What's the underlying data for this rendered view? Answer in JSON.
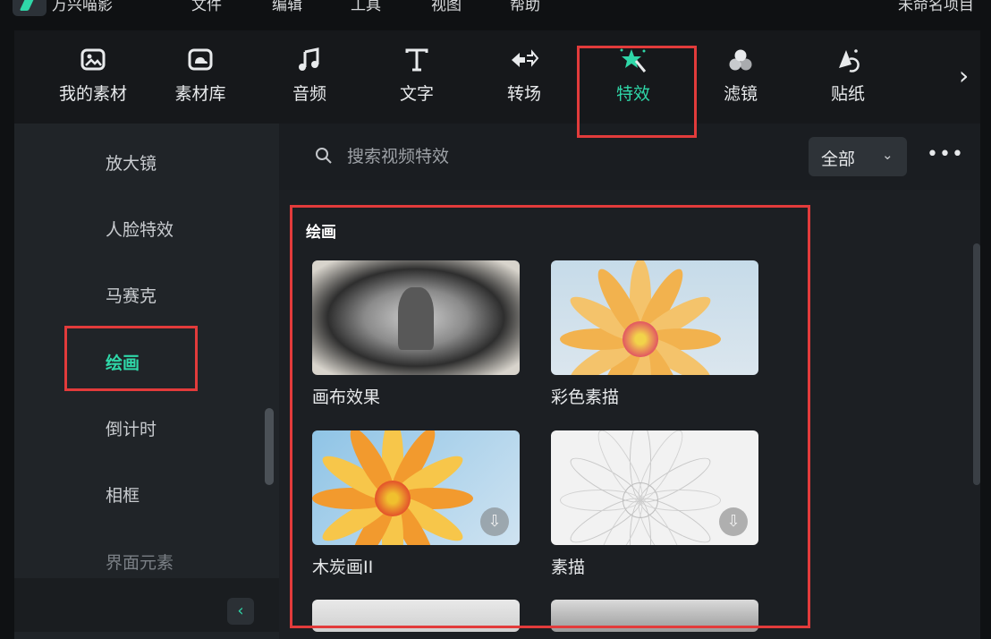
{
  "menubar": {
    "items": [
      "万兴喵影",
      "文件",
      "编辑",
      "工具",
      "视图",
      "帮助",
      "未命名项目"
    ]
  },
  "toolbar": {
    "tools": [
      {
        "label": "我的素材",
        "icon": "my-media-icon"
      },
      {
        "label": "素材库",
        "icon": "library-icon"
      },
      {
        "label": "音频",
        "icon": "music-note-icon"
      },
      {
        "label": "文字",
        "icon": "text-icon"
      },
      {
        "label": "转场",
        "icon": "transition-icon"
      },
      {
        "label": "特效",
        "icon": "effects-wand-icon"
      },
      {
        "label": "滤镜",
        "icon": "filter-icon"
      },
      {
        "label": "贴纸",
        "icon": "sticker-icon"
      }
    ],
    "active": "特效",
    "accent_color": "#2fd7a8"
  },
  "sidebar": {
    "categories": [
      "放大镜",
      "人脸特效",
      "马赛克",
      "绘画",
      "倒计时",
      "相框",
      "界面元素"
    ],
    "active": "绘画"
  },
  "search": {
    "placeholder": "搜索视频特效",
    "filter_label": "全部"
  },
  "section": {
    "title": "绘画",
    "effects": [
      {
        "label": "画布效果",
        "downloadable": false
      },
      {
        "label": "彩色素描",
        "downloadable": false
      },
      {
        "label": "木炭画II",
        "downloadable": true
      },
      {
        "label": "素描",
        "downloadable": true
      }
    ]
  },
  "annotation_color": "#e23b3b"
}
